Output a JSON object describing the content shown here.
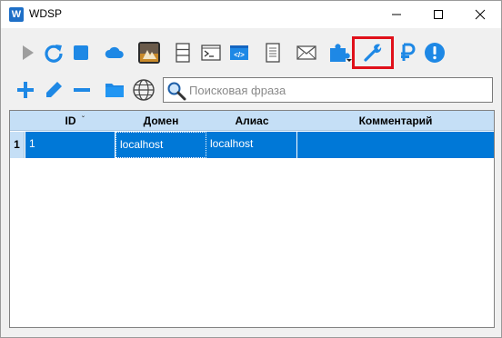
{
  "window": {
    "title": "WDSP",
    "logo_letter": "W"
  },
  "toolbar_row1": [
    {
      "icon": "play-icon",
      "color": "#a0a0a0"
    },
    {
      "icon": "refresh-icon",
      "color": "#1e88e5"
    },
    {
      "icon": "stop-icon",
      "color": "#1e88e5"
    },
    {
      "icon": "cloud-icon",
      "color": "#1e88e5"
    },
    {
      "icon": "landscape-image-icon"
    },
    {
      "icon": "panels-icon"
    },
    {
      "icon": "terminal-icon"
    },
    {
      "icon": "code-icon",
      "color": "#1e88e5"
    },
    {
      "icon": "document-icon"
    },
    {
      "icon": "mail-icon"
    },
    {
      "icon": "plugin-dropdown-icon",
      "color": "#1e88e5"
    },
    {
      "icon": "wrench-icon",
      "color": "#1e88e5",
      "highlighted": true
    },
    {
      "icon": "ruble-icon",
      "color": "#1e88e5"
    },
    {
      "icon": "alert-icon",
      "color": "#1e88e5"
    }
  ],
  "toolbar_row2": [
    {
      "icon": "add-icon"
    },
    {
      "icon": "edit-icon"
    },
    {
      "icon": "remove-icon"
    },
    {
      "icon": "folder-icon"
    },
    {
      "icon": "globe-icon"
    }
  ],
  "search": {
    "placeholder": "Поисковая фраза",
    "value": ""
  },
  "table": {
    "columns": [
      "ID",
      "Домен",
      "Алиас",
      "Комментарий"
    ],
    "rows": [
      {
        "indicator": "1",
        "cells": [
          "1",
          "localhost",
          "localhost",
          ""
        ]
      }
    ]
  },
  "colors": {
    "accent": "#1e88e5",
    "selection": "#0078d7",
    "header": "#c5dff6",
    "highlight_box": "#e0101a"
  }
}
